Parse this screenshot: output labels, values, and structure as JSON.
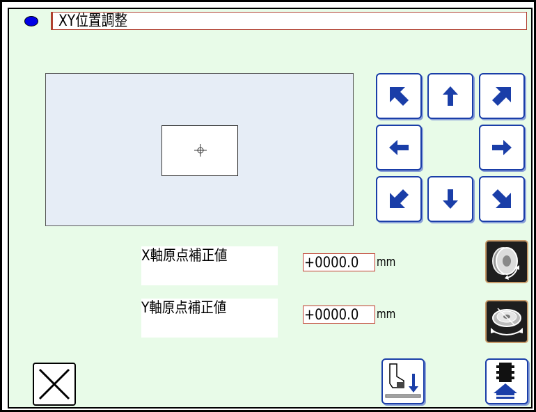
{
  "header": {
    "title": "XY位置調整"
  },
  "preview": {
    "crosshair_icon": "crosshair-icon"
  },
  "jog_buttons": [
    {
      "name": "jog-up-left-button",
      "icon": "arrow-up-left-icon"
    },
    {
      "name": "jog-up-button",
      "icon": "arrow-up-icon"
    },
    {
      "name": "jog-up-right-button",
      "icon": "arrow-up-right-icon"
    },
    {
      "name": "jog-left-button",
      "icon": "arrow-left-icon"
    },
    {
      "name": "jog-right-button",
      "icon": "arrow-right-icon"
    },
    {
      "name": "jog-down-left-button",
      "icon": "arrow-down-left-icon"
    },
    {
      "name": "jog-down-button",
      "icon": "arrow-down-icon"
    },
    {
      "name": "jog-down-right-button",
      "icon": "arrow-down-right-icon"
    }
  ],
  "fields": {
    "x_offset": {
      "label": "X軸原点補正値",
      "value": "+0000.0",
      "unit": "mm"
    },
    "y_offset": {
      "label": "Y軸原点補正値",
      "value": "+0000.0",
      "unit": "mm"
    }
  },
  "colors": {
    "background": "#e8fbe8",
    "button_border": "#1a3ea8",
    "arrow": "#1a3ea8",
    "value_border": "#c0392b",
    "title_dot": "#0000e6"
  }
}
